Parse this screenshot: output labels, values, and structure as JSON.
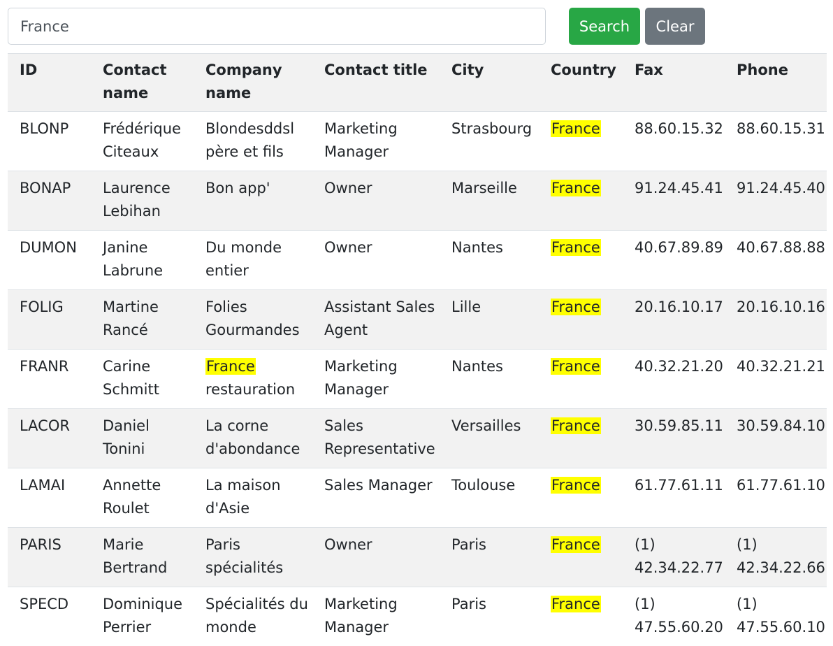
{
  "search": {
    "value": "France",
    "placeholder": "",
    "search_label": "Search",
    "clear_label": "Clear",
    "highlight_term": "France"
  },
  "colors": {
    "search_button": "#28a745",
    "clear_button": "#6c757d",
    "highlight": "#ffff00",
    "striped_row": "#f2f2f2"
  },
  "table": {
    "headers": [
      "ID",
      "Contact name",
      "Company name",
      "Contact title",
      "City",
      "Country",
      "Fax",
      "Phone"
    ],
    "rows": [
      [
        "BLONP",
        "Frédérique Citeaux",
        "Blondesddsl père et fils",
        "Marketing Manager",
        "Strasbourg",
        "France",
        "88.60.15.32",
        "88.60.15.31"
      ],
      [
        "BONAP",
        "Laurence Lebihan",
        "Bon app'",
        "Owner",
        "Marseille",
        "France",
        "91.24.45.41",
        "91.24.45.40"
      ],
      [
        "DUMON",
        "Janine Labrune",
        "Du monde entier",
        "Owner",
        "Nantes",
        "France",
        "40.67.89.89",
        "40.67.88.88"
      ],
      [
        "FOLIG",
        "Martine Rancé",
        "Folies Gourmandes",
        "Assistant Sales Agent",
        "Lille",
        "France",
        "20.16.10.17",
        "20.16.10.16"
      ],
      [
        "FRANR",
        "Carine Schmitt",
        "France restauration",
        "Marketing Manager",
        "Nantes",
        "France",
        "40.32.21.20",
        "40.32.21.21"
      ],
      [
        "LACOR",
        "Daniel Tonini",
        "La corne d'abondance",
        "Sales Representative",
        "Versailles",
        "France",
        "30.59.85.11",
        "30.59.84.10"
      ],
      [
        "LAMAI",
        "Annette Roulet",
        "La maison d'Asie",
        "Sales Manager",
        "Toulouse",
        "France",
        "61.77.61.11",
        "61.77.61.10"
      ],
      [
        "PARIS",
        "Marie Bertrand",
        "Paris spécialités",
        "Owner",
        "Paris",
        "France",
        "(1) 42.34.22.77",
        "(1) 42.34.22.66"
      ],
      [
        "SPECD",
        "Dominique Perrier",
        "Spécialités du monde",
        "Marketing Manager",
        "Paris",
        "France",
        "(1) 47.55.60.20",
        "(1) 47.55.60.10"
      ]
    ]
  }
}
